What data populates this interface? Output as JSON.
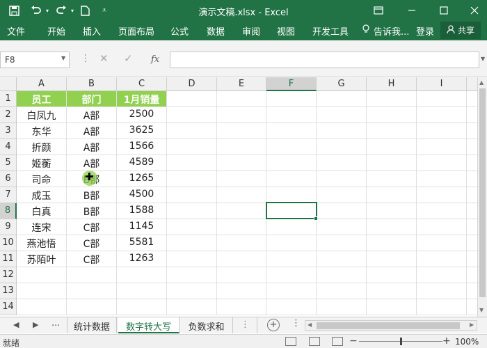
{
  "window": {
    "title": "演示文稿.xlsx - Excel"
  },
  "ribbon": {
    "tabs": [
      "文件",
      "开始",
      "插入",
      "页面布局",
      "公式",
      "数据",
      "审阅",
      "视图",
      "开发工具"
    ],
    "tell_me": "告诉我...",
    "login": "登录",
    "share": "共享"
  },
  "formula_bar": {
    "name_box": "F8",
    "fx": "fx",
    "formula": ""
  },
  "columns": [
    "A",
    "B",
    "C",
    "D",
    "E",
    "F",
    "G",
    "H",
    "I"
  ],
  "rows": [
    "1",
    "2",
    "3",
    "4",
    "5",
    "6",
    "7",
    "8",
    "9",
    "10",
    "11",
    "12",
    "13",
    "14"
  ],
  "table": {
    "headers": [
      "员工",
      "部门",
      "1月销量"
    ],
    "data": [
      [
        "白凤九",
        "A部",
        "2500"
      ],
      [
        "东华",
        "A部",
        "3625"
      ],
      [
        "折颜",
        "A部",
        "1566"
      ],
      [
        "姬蘅",
        "A部",
        "4589"
      ],
      [
        "司命",
        "B部",
        "1265"
      ],
      [
        "成玉",
        "B部",
        "4500"
      ],
      [
        "白真",
        "B部",
        "1588"
      ],
      [
        "连宋",
        "C部",
        "1145"
      ],
      [
        "燕池悟",
        "C部",
        "5581"
      ],
      [
        "苏陌叶",
        "C部",
        "1263"
      ]
    ]
  },
  "selected_cell": "F8",
  "sheets": {
    "tabs": [
      "统计数据",
      "数字转大写",
      "负数求和"
    ],
    "active": "数字转大写",
    "nav_more": "..."
  },
  "status": {
    "text": "就绪",
    "zoom": "100%"
  },
  "colors": {
    "excel_green": "#217346",
    "header_fill": "#92d050"
  }
}
